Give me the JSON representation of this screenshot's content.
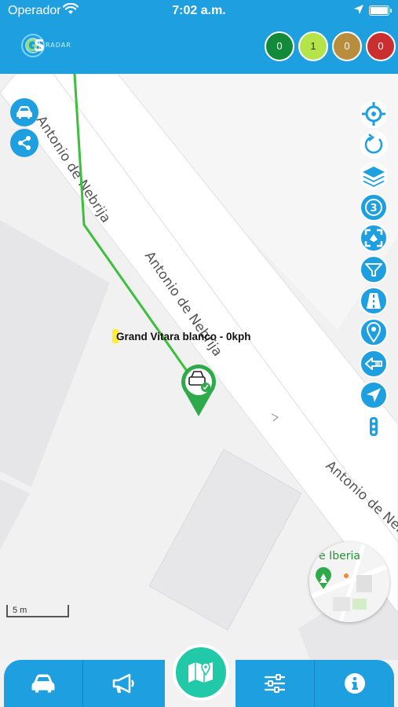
{
  "status_bar": {
    "carrier": "Operador",
    "time": "7:02 a.m."
  },
  "header": {
    "logo_text": "RADAR",
    "counters": [
      {
        "value": "0",
        "color": "#128a3a"
      },
      {
        "value": "1",
        "color": "#b5e34a"
      },
      {
        "value": "0",
        "color": "#b88e3e"
      },
      {
        "value": "0",
        "color": "#c92f2f"
      }
    ]
  },
  "map": {
    "streets": [
      "Antonio de Nebrija",
      "Antonio de Nebrija",
      "Antonio de Neb"
    ],
    "vehicle_label": "Grand Vitara blanco - 0kph",
    "scale_label": "5 m",
    "minimap_label": "e Iberia"
  },
  "left_tools": [
    {
      "name": "vehicle-button",
      "icon": "car-icon"
    },
    {
      "name": "share-button",
      "icon": "share-icon"
    }
  ],
  "right_tools": [
    {
      "icon": "crosshair-icon"
    },
    {
      "icon": "refresh-icon"
    },
    {
      "icon": "layers-icon"
    },
    {
      "icon": "number-3-icon",
      "text": "3"
    },
    {
      "icon": "fit-screen-icon"
    },
    {
      "icon": "filter-icon"
    },
    {
      "icon": "road-icon"
    },
    {
      "icon": "pin-icon"
    },
    {
      "icon": "arrow-left-icon"
    },
    {
      "icon": "navigation-icon"
    },
    {
      "icon": "traffic-light-icon"
    }
  ],
  "bottom_nav": [
    {
      "icon": "car-icon"
    },
    {
      "icon": "megaphone-icon"
    },
    {
      "icon": "map-icon"
    },
    {
      "icon": "sliders-icon"
    },
    {
      "icon": "info-icon"
    }
  ],
  "colors": {
    "primary": "#1e9fe0",
    "accent": "#21c9a8",
    "route": "#3cbf3c",
    "marker": "#2eaa4a"
  }
}
